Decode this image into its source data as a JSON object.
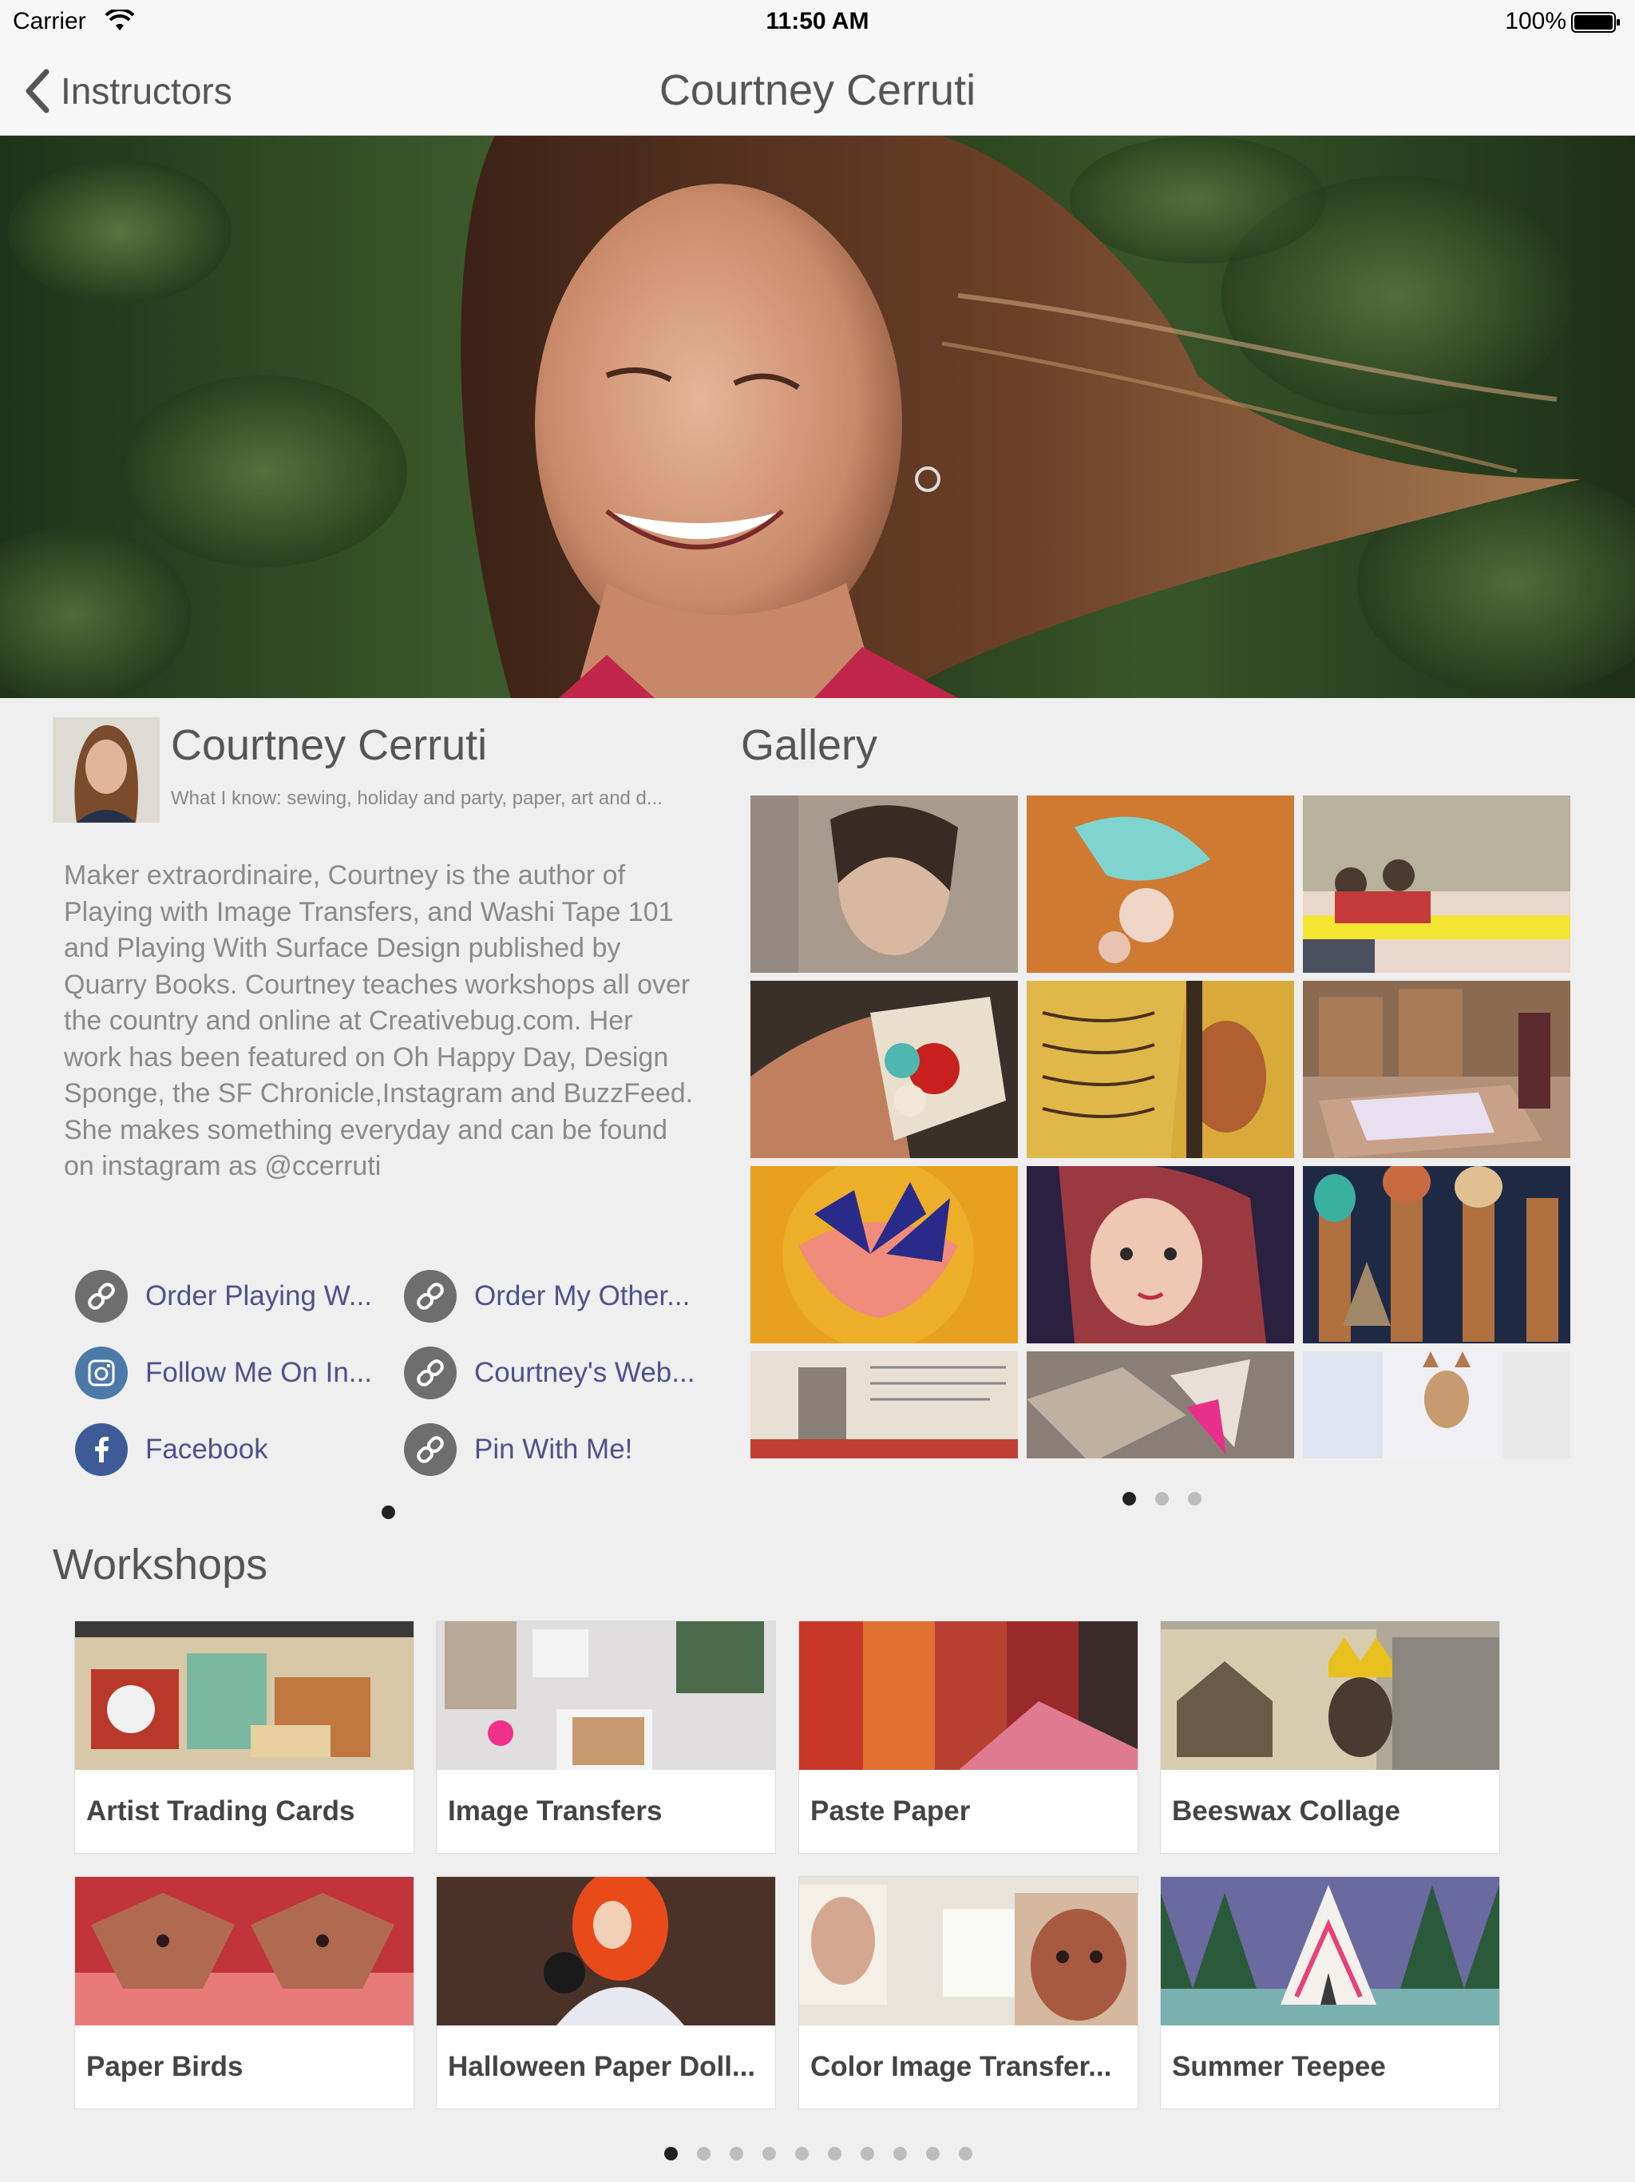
{
  "status_bar": {
    "carrier": "Carrier",
    "time": "11:50 AM",
    "battery_pct": "100%"
  },
  "nav": {
    "back_label": "Instructors",
    "title": "Courtney Cerruti"
  },
  "profile": {
    "name": "Courtney Cerruti",
    "knows": "What I know: sewing, holiday and party, paper, art and d...",
    "bio": "Maker extraordinaire, Courtney is the author of Playing with Image Transfers, and Washi Tape 101 and Playing With Surface Design published by Quarry Books. Courtney teaches workshops all over the country and online at Creativebug.com. Her work has been featured on Oh Happy Day, Design Sponge, the SF Chronicle,Instagram and BuzzFeed. She makes something everyday and can be found on instagram as @ccerruti"
  },
  "links": [
    {
      "label": "Order Playing W...",
      "icon": "link-icon"
    },
    {
      "label": "Order My Other...",
      "icon": "link-icon"
    },
    {
      "label": "Follow Me On In...",
      "icon": "instagram-icon"
    },
    {
      "label": "Courtney's Web...",
      "icon": "link-icon"
    },
    {
      "label": "Facebook",
      "icon": "facebook-icon"
    },
    {
      "label": "Pin With Me!",
      "icon": "link-icon"
    }
  ],
  "links_pager": {
    "pages": 1,
    "current": 1
  },
  "gallery": {
    "title": "Gallery",
    "pager": {
      "pages": 3,
      "current": 1
    }
  },
  "workshops": {
    "title": "Workshops",
    "items": [
      {
        "title": "Artist Trading Cards"
      },
      {
        "title": "Image Transfers"
      },
      {
        "title": "Paste Paper"
      },
      {
        "title": "Beeswax Collage"
      },
      {
        "title": "Paper Birds"
      },
      {
        "title": "Halloween Paper Doll..."
      },
      {
        "title": "Color Image Transfer..."
      },
      {
        "title": "Summer Teepee"
      }
    ],
    "pager": {
      "pages": 10,
      "current": 1
    }
  },
  "colors": {
    "link": "#514f8e",
    "background": "#efefef",
    "nav_background": "#f7f7f7"
  }
}
